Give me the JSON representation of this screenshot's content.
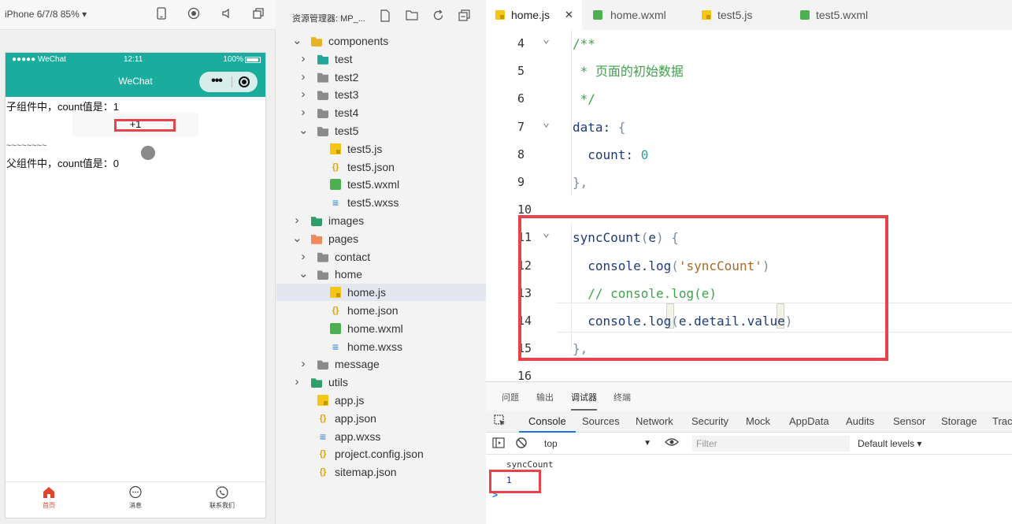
{
  "simulator": {
    "device": "iPhone 6/7/8 85% ▾",
    "status_left": "●●●●● WeChat",
    "status_time": "12:11",
    "status_battery": "100%",
    "nav_title": "WeChat",
    "child_text": "子组件中，count值是：1",
    "plus_label": "+1",
    "tilde_text": "~~~~~~~~",
    "parent_text": "父组件中，count值是：0",
    "tabbar": [
      {
        "label": "首页",
        "icon": "home-icon"
      },
      {
        "label": "消息",
        "icon": "message-icon"
      },
      {
        "label": "联系我们",
        "icon": "phone-icon"
      }
    ]
  },
  "explorer": {
    "title": "资源管理器: MP_...",
    "tree": [
      {
        "label": "components",
        "chev": "∨",
        "icon": "folder-yellow"
      },
      {
        "label": "test",
        "chev": ">",
        "icon": "folder-teal"
      },
      {
        "label": "test2",
        "chev": ">",
        "icon": "folder"
      },
      {
        "label": "test3",
        "chev": ">",
        "icon": "folder"
      },
      {
        "label": "test4",
        "chev": ">",
        "icon": "folder"
      },
      {
        "label": "test5",
        "chev": "∨",
        "icon": "folder"
      },
      {
        "label": "test5.js",
        "chev": "",
        "icon": "js"
      },
      {
        "label": "test5.json",
        "chev": "",
        "icon": "json"
      },
      {
        "label": "test5.wxml",
        "chev": "",
        "icon": "wxml"
      },
      {
        "label": "test5.wxss",
        "chev": "",
        "icon": "wxss"
      },
      {
        "label": "images",
        "chev": ">",
        "icon": "folder-green"
      },
      {
        "label": "pages",
        "chev": "∨",
        "icon": "folder-orange"
      },
      {
        "label": "contact",
        "chev": ">",
        "icon": "folder"
      },
      {
        "label": "home",
        "chev": "∨",
        "icon": "folder"
      },
      {
        "label": "home.js",
        "chev": "",
        "icon": "js"
      },
      {
        "label": "home.json",
        "chev": "",
        "icon": "json"
      },
      {
        "label": "home.wxml",
        "chev": "",
        "icon": "wxml"
      },
      {
        "label": "home.wxss",
        "chev": "",
        "icon": "wxss"
      },
      {
        "label": "message",
        "chev": ">",
        "icon": "folder"
      },
      {
        "label": "utils",
        "chev": ">",
        "icon": "folder-green"
      },
      {
        "label": "app.js",
        "chev": "",
        "icon": "js"
      },
      {
        "label": "app.json",
        "chev": "",
        "icon": "json"
      },
      {
        "label": "app.wxss",
        "chev": "",
        "icon": "wxss"
      },
      {
        "label": "project.config.json",
        "chev": "",
        "icon": "json"
      },
      {
        "label": "sitemap.json",
        "chev": "",
        "icon": "json"
      }
    ]
  },
  "editor": {
    "tabs": [
      {
        "label": "home.js",
        "icon": "js",
        "close": "✕"
      },
      {
        "label": "home.wxml",
        "icon": "wxml"
      },
      {
        "label": "test5.js",
        "icon": "js"
      },
      {
        "label": "test5.wxml",
        "icon": "wxml"
      }
    ],
    "lines": [
      {
        "n": "4",
        "fold": "∨",
        "code": "/**"
      },
      {
        "n": "5",
        "fold": "",
        "code": " * 页面的初始数据"
      },
      {
        "n": "6",
        "fold": "",
        "code": " */"
      },
      {
        "n": "7",
        "fold": "∨",
        "code": "data: {"
      },
      {
        "n": "8",
        "fold": "",
        "code": "  count: 0"
      },
      {
        "n": "9",
        "fold": "",
        "code": "},"
      },
      {
        "n": "10",
        "fold": "",
        "code": ""
      },
      {
        "n": "11",
        "fold": "∨",
        "code": "syncCount(e) {"
      },
      {
        "n": "12",
        "fold": "",
        "code": "  console.log('syncCount')"
      },
      {
        "n": "13",
        "fold": "",
        "code": "  // console.log(e)"
      },
      {
        "n": "14",
        "fold": "",
        "code": "  console.log(e.detail.value)"
      },
      {
        "n": "15",
        "fold": "",
        "code": "},"
      },
      {
        "n": "16",
        "fold": "",
        "code": ""
      }
    ]
  },
  "console": {
    "panel_tabs": [
      "问题",
      "输出",
      "调试器",
      "终端"
    ],
    "active_panel_tab": "调试器",
    "devtools_tabs": [
      "Console",
      "Sources",
      "Network",
      "Security",
      "Mock",
      "AppData",
      "Audits",
      "Sensor",
      "Storage",
      "Trac"
    ],
    "context": "top",
    "filter_placeholder": "Filter",
    "levels": "Default levels ▾",
    "logs": [
      "syncCount",
      "1"
    ],
    "prompt": ">"
  }
}
